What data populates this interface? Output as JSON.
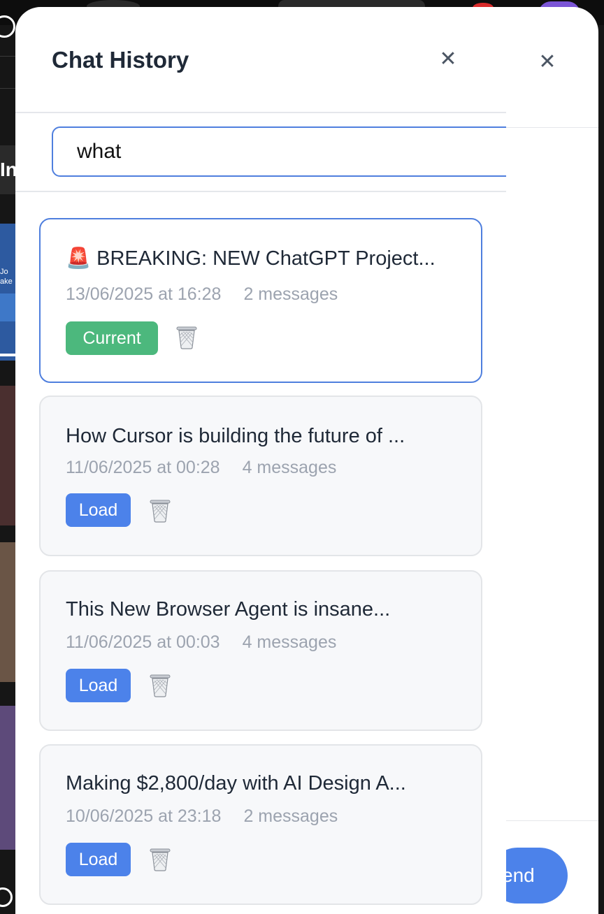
{
  "modal": {
    "title": "Chat History",
    "close_icon": "close-icon"
  },
  "search": {
    "value": "what",
    "placeholder": ""
  },
  "chats": [
    {
      "emoji": "🚨",
      "title": "BREAKING: NEW ChatGPT Project...",
      "date": "13/06/2025 at 16:28",
      "messages": "2 messages",
      "action": "Current",
      "is_current": true
    },
    {
      "emoji": "",
      "title": "How Cursor is building the future of ...",
      "date": "11/06/2025 at 00:28",
      "messages": "4 messages",
      "action": "Load",
      "is_current": false
    },
    {
      "emoji": "",
      "title": "This New Browser Agent is insane...",
      "date": "11/06/2025 at 00:03",
      "messages": "4 messages",
      "action": "Load",
      "is_current": false
    },
    {
      "emoji": "",
      "title": "Making $2,800/day with AI Design A...",
      "date": "10/06/2025 at 23:18",
      "messages": "2 messages",
      "action": "Load",
      "is_current": false
    }
  ],
  "side_panel": {
    "close_icon": "close-icon",
    "send_label": "end"
  },
  "background": {
    "partial_heading": "In",
    "thumb_text": "Jo\nake"
  },
  "colors": {
    "accent": "#4f7fde",
    "load_button": "#4c82ea",
    "current_badge": "#4cb87d",
    "title_text": "#1f2937",
    "meta_text": "#9ca3af"
  }
}
